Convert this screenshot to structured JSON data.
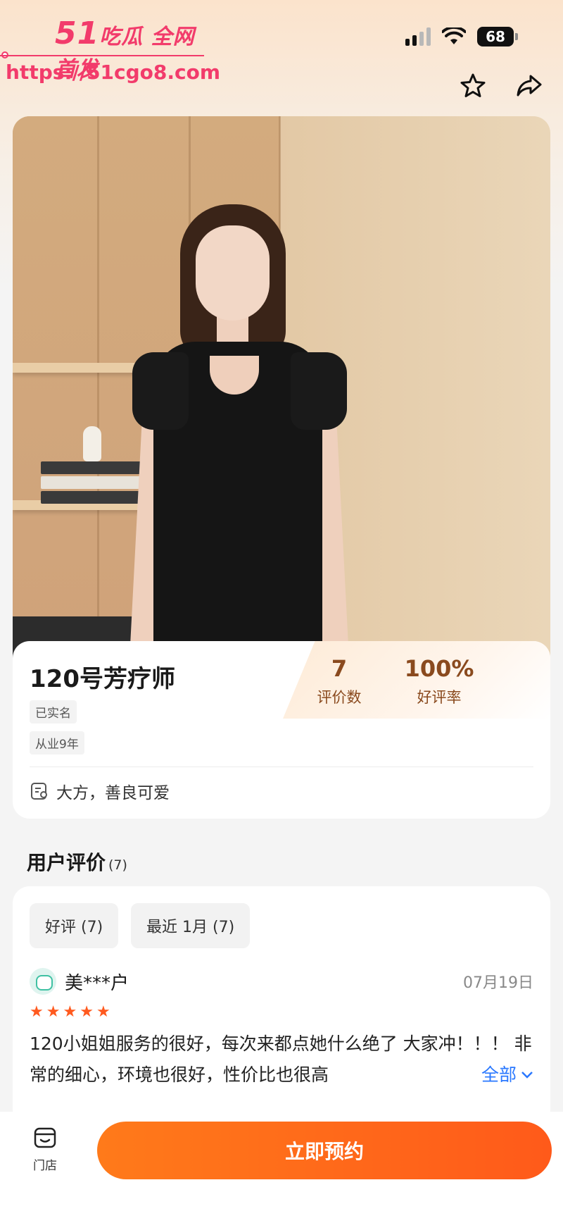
{
  "watermark": {
    "brand_num": "51",
    "brand_text": "吃瓜 全网首发",
    "url": "https://51cgo8.com"
  },
  "status_bar": {
    "battery": "68"
  },
  "header": {
    "favorite_icon": "star-outline-icon",
    "share_icon": "share-arrow-icon"
  },
  "therapist": {
    "name": "120号芳疗师",
    "tags": [
      "已实名",
      "从业9年"
    ],
    "stats": [
      {
        "value": "7",
        "label": "评价数"
      },
      {
        "value": "100%",
        "label": "好评率"
      }
    ],
    "intro": "大方，善良可爱"
  },
  "reviews": {
    "title": "用户评价",
    "count": "(7)",
    "filters": [
      "好评 (7)",
      "最近 1月 (7)"
    ],
    "items": [
      {
        "user": "美***户",
        "date": "07月19日",
        "rating": 5,
        "text": "120小姐姐服务的很好，每次来都点她什么绝了 大家冲！！！ 非常的细心，环境也很好，性价比也很高",
        "more_label": "全部"
      }
    ]
  },
  "bottom_bar": {
    "store_label": "门店",
    "book_label": "立即预约"
  },
  "colors": {
    "accent": "#ff6a1a",
    "stat_brown": "#8a4a1e",
    "link_blue": "#2a78ff",
    "watermark_pink": "#f23b6b"
  }
}
